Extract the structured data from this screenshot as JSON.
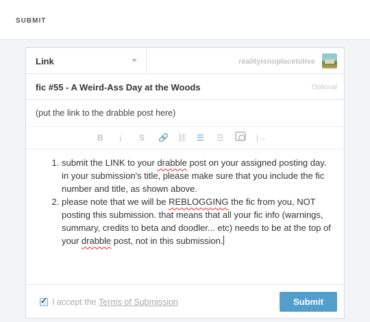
{
  "header": {
    "title": "SUBMIT"
  },
  "form": {
    "post_type": "Link",
    "blog_name": "realityisnoplacetolive",
    "title": "fic #55 - A Weird-Ass Day at the Woods",
    "title_hint": "Optional",
    "url": "(put the link to the drabble post here)"
  },
  "toolbar": {
    "bold": "B",
    "italic": "i",
    "strike": "S",
    "link": "🔗",
    "unlink": "⛓",
    "ordered_list": "☰",
    "unordered_list": "☰",
    "image_icon": "image-icon",
    "read_more": "|→"
  },
  "body": {
    "items": [
      {
        "before": "submit the LINK to your ",
        "sq": "drabble",
        "after": " post on your assigned posting day. in your submission's title, please make sure that you include the fic number and title, as shown above."
      },
      {
        "before": "please note that we will be ",
        "sq": "REBLOGGING",
        "mid": " the fic from you, NOT posting this submission. that means that all your fic info (warnings, summary, credits to beta and doodler... etc) needs to be at the top of your ",
        "sq2": "drabble",
        "after": " post, not in this submission."
      }
    ]
  },
  "footer": {
    "accept_prefix": "I accept the ",
    "terms_label": "Terms of Submission",
    "submit_label": "Submit",
    "checked": true
  },
  "colors": {
    "accent": "#529ecc",
    "active_icon": "#56a3d9"
  }
}
